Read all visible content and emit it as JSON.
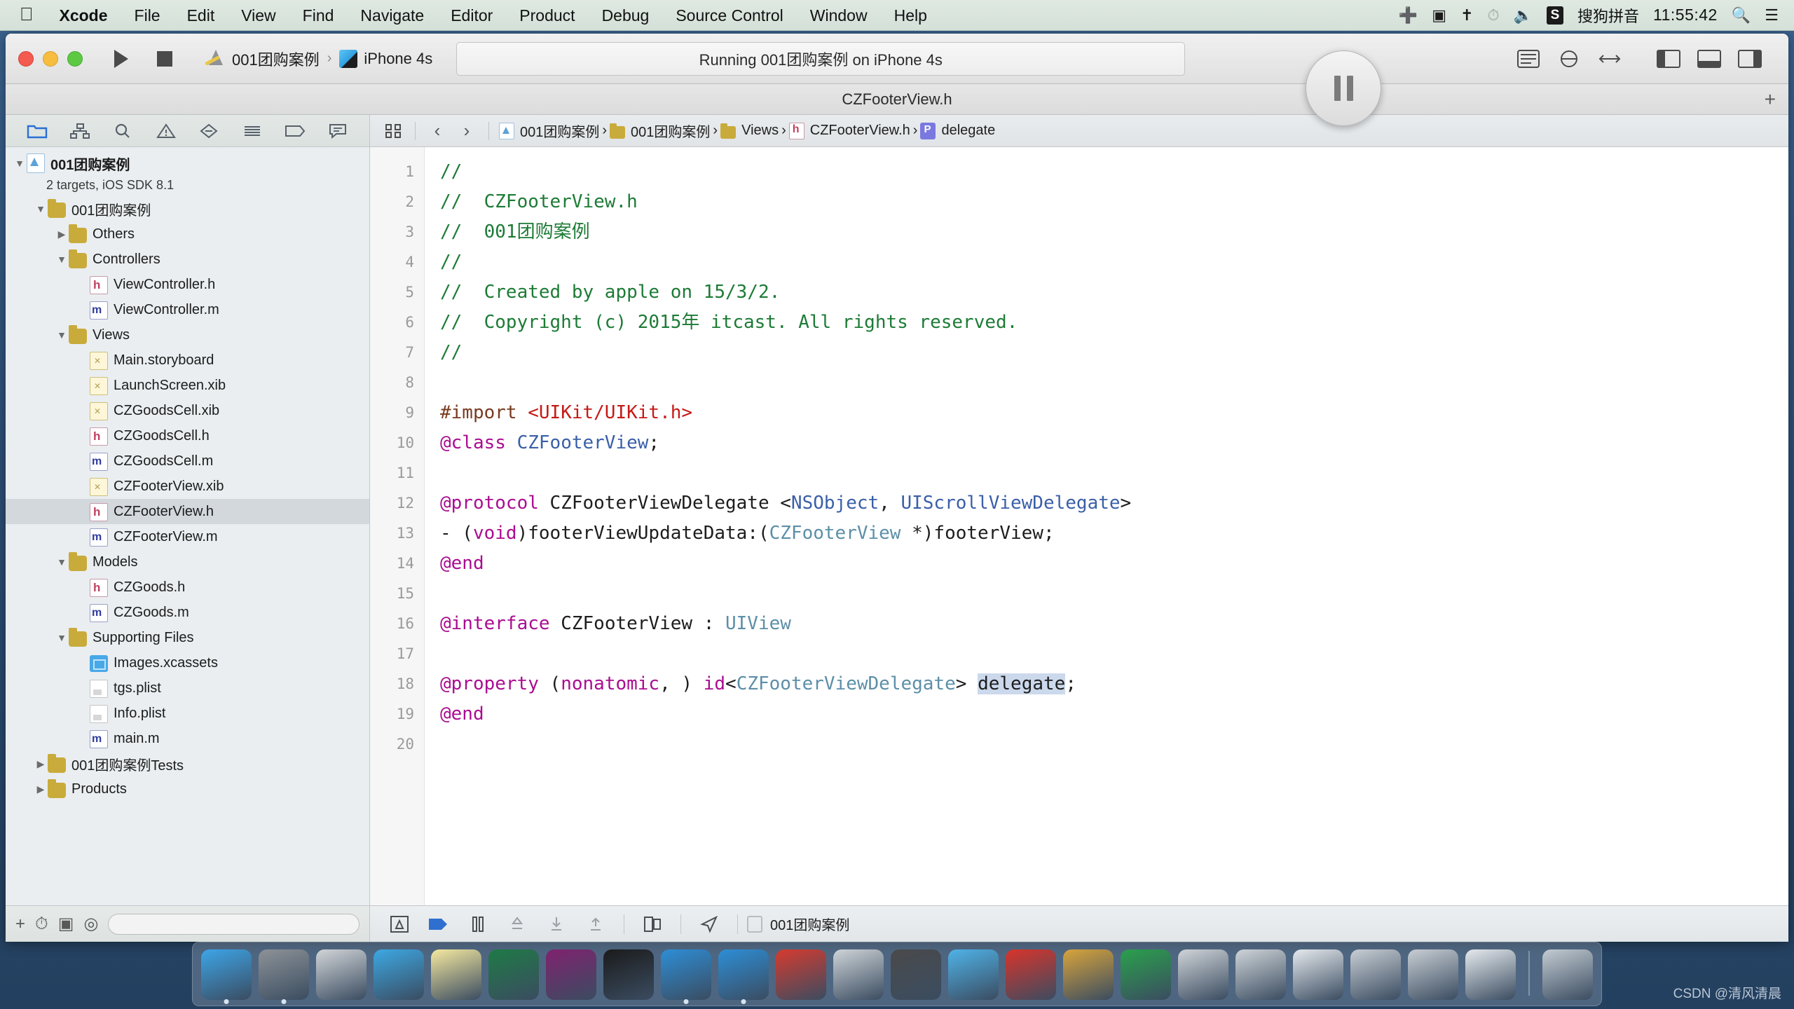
{
  "menubar": {
    "apple_icon": "apple-icon",
    "items": [
      "Xcode",
      "File",
      "Edit",
      "View",
      "Find",
      "Navigate",
      "Editor",
      "Product",
      "Debug",
      "Source Control",
      "Window",
      "Help"
    ],
    "status": {
      "airplay_icon": "airplay-icon",
      "screen_record_icon": "screen-record-icon",
      "bluetooth_icon": "bluetooth-icon",
      "timemachine_icon": "time-machine-icon",
      "volume_icon": "volume-icon",
      "input_badge": "S",
      "input_method": "搜狗拼音",
      "clock": "11:55:42",
      "search_icon": "search-icon",
      "notification_icon": "notification-center-icon"
    }
  },
  "toolbar": {
    "run_label": "Run",
    "stop_label": "Stop",
    "scheme": "001团购案例",
    "destination": "iPhone 4s",
    "activity_status": "Running 001团购案例 on iPhone 4s",
    "pause_label": "Pause",
    "editor_standard": "standard-editor",
    "editor_assistant": "assistant-editor",
    "editor_version": "version-editor",
    "view_navigator": "toggle-navigator",
    "view_debug": "toggle-debug-area",
    "view_utilities": "toggle-utilities"
  },
  "titlebar": {
    "title": "CZFooterView.h",
    "add_tab": "+"
  },
  "navigator": {
    "tabs": [
      {
        "name": "project-navigator",
        "icon": "folder-icon",
        "active": true
      },
      {
        "name": "symbol-navigator",
        "icon": "hierarchy-icon",
        "active": false
      },
      {
        "name": "find-navigator",
        "icon": "search-icon",
        "active": false
      },
      {
        "name": "issue-navigator",
        "icon": "warning-icon",
        "active": false
      },
      {
        "name": "test-navigator",
        "icon": "diamond-icon",
        "active": false
      },
      {
        "name": "debug-navigator",
        "icon": "list-icon",
        "active": false
      },
      {
        "name": "breakpoint-navigator",
        "icon": "tag-icon",
        "active": false
      },
      {
        "name": "log-navigator",
        "icon": "speech-icon",
        "active": false
      }
    ],
    "tree": [
      {
        "label": "001团购案例",
        "sub": "2 targets, iOS SDK 8.1",
        "indent": 0,
        "twisty": "down",
        "icon": "proj",
        "bold": true
      },
      {
        "label": "001团购案例",
        "indent": 1,
        "twisty": "down",
        "icon": "folder"
      },
      {
        "label": "Others",
        "indent": 2,
        "twisty": "right",
        "icon": "folder"
      },
      {
        "label": "Controllers",
        "indent": 2,
        "twisty": "down",
        "icon": "folder"
      },
      {
        "label": "ViewController.h",
        "indent": 3,
        "twisty": "",
        "icon": "h-file"
      },
      {
        "label": "ViewController.m",
        "indent": 3,
        "twisty": "",
        "icon": "m-file"
      },
      {
        "label": "Views",
        "indent": 2,
        "twisty": "down",
        "icon": "folder"
      },
      {
        "label": "Main.storyboard",
        "indent": 3,
        "twisty": "",
        "icon": "xib"
      },
      {
        "label": "LaunchScreen.xib",
        "indent": 3,
        "twisty": "",
        "icon": "xib"
      },
      {
        "label": "CZGoodsCell.xib",
        "indent": 3,
        "twisty": "",
        "icon": "xib"
      },
      {
        "label": "CZGoodsCell.h",
        "indent": 3,
        "twisty": "",
        "icon": "h-file"
      },
      {
        "label": "CZGoodsCell.m",
        "indent": 3,
        "twisty": "",
        "icon": "m-file"
      },
      {
        "label": "CZFooterView.xib",
        "indent": 3,
        "twisty": "",
        "icon": "xib"
      },
      {
        "label": "CZFooterView.h",
        "indent": 3,
        "twisty": "",
        "icon": "h-file",
        "selected": true
      },
      {
        "label": "CZFooterView.m",
        "indent": 3,
        "twisty": "",
        "icon": "m-file"
      },
      {
        "label": "Models",
        "indent": 2,
        "twisty": "down",
        "icon": "folder"
      },
      {
        "label": "CZGoods.h",
        "indent": 3,
        "twisty": "",
        "icon": "h-file"
      },
      {
        "label": "CZGoods.m",
        "indent": 3,
        "twisty": "",
        "icon": "m-file"
      },
      {
        "label": "Supporting Files",
        "indent": 2,
        "twisty": "down",
        "icon": "folder"
      },
      {
        "label": "Images.xcassets",
        "indent": 3,
        "twisty": "",
        "icon": "xcassets"
      },
      {
        "label": "tgs.plist",
        "indent": 3,
        "twisty": "",
        "icon": "plist"
      },
      {
        "label": "Info.plist",
        "indent": 3,
        "twisty": "",
        "icon": "plist"
      },
      {
        "label": "main.m",
        "indent": 3,
        "twisty": "",
        "icon": "m-file"
      },
      {
        "label": "001团购案例Tests",
        "indent": 1,
        "twisty": "right",
        "icon": "folder"
      },
      {
        "label": "Products",
        "indent": 1,
        "twisty": "right",
        "icon": "folder"
      }
    ],
    "filter_placeholder": "",
    "add_button": "+",
    "recent_button": "recent-icon",
    "sourcecontrol_button": "source-control-icon",
    "filter_button": "filter-icon"
  },
  "jumpbar": {
    "related_icon": "related-items-icon",
    "back": "‹",
    "forward": "›",
    "crumbs": [
      {
        "label": "001团购案例",
        "icon": "proj"
      },
      {
        "label": "001团购案例",
        "icon": "folder"
      },
      {
        "label": "Views",
        "icon": "folder"
      },
      {
        "label": "CZFooterView.h",
        "icon": "h"
      },
      {
        "label": "delegate",
        "icon": "p"
      }
    ]
  },
  "code": {
    "line_numbers": [
      "1",
      "2",
      "3",
      "4",
      "5",
      "6",
      "7",
      "8",
      "9",
      "10",
      "11",
      "12",
      "13",
      "14",
      "15",
      "16",
      "17",
      "18",
      "19",
      "20"
    ],
    "lines": [
      {
        "n": 1,
        "tokens": [
          {
            "t": "//",
            "c": "cm"
          }
        ]
      },
      {
        "n": 2,
        "tokens": [
          {
            "t": "//  CZFooterView.h",
            "c": "cm"
          }
        ]
      },
      {
        "n": 3,
        "tokens": [
          {
            "t": "//  001团购案例",
            "c": "cm"
          }
        ]
      },
      {
        "n": 4,
        "tokens": [
          {
            "t": "//",
            "c": "cm"
          }
        ]
      },
      {
        "n": 5,
        "tokens": [
          {
            "t": "//  Created by apple on 15/3/2.",
            "c": "cm"
          }
        ]
      },
      {
        "n": 6,
        "tokens": [
          {
            "t": "//  Copyright (c) 2015年 itcast. All rights reserved.",
            "c": "cm"
          }
        ]
      },
      {
        "n": 7,
        "tokens": [
          {
            "t": "//",
            "c": "cm"
          }
        ]
      },
      {
        "n": 8,
        "tokens": []
      },
      {
        "n": 9,
        "tokens": [
          {
            "t": "#import ",
            "c": "pre"
          },
          {
            "t": "<UIKit/UIKit.h>",
            "c": "str"
          }
        ]
      },
      {
        "n": 10,
        "tokens": [
          {
            "t": "@class",
            "c": "kw"
          },
          {
            "t": " ",
            "c": ""
          },
          {
            "t": "CZFooterView",
            "c": "cls"
          },
          {
            "t": ";",
            "c": ""
          }
        ]
      },
      {
        "n": 11,
        "tokens": []
      },
      {
        "n": 12,
        "tokens": [
          {
            "t": "@protocol",
            "c": "kw"
          },
          {
            "t": " CZFooterViewDelegate <",
            "c": ""
          },
          {
            "t": "NSObject",
            "c": "cls"
          },
          {
            "t": ", ",
            "c": ""
          },
          {
            "t": "UIScrollViewDelegate",
            "c": "cls"
          },
          {
            "t": ">",
            "c": ""
          }
        ]
      },
      {
        "n": 13,
        "tokens": [
          {
            "t": "- (",
            "c": ""
          },
          {
            "t": "void",
            "c": "kw"
          },
          {
            "t": ")footerViewUpdateData:(",
            "c": ""
          },
          {
            "t": "CZFooterView",
            "c": "typ"
          },
          {
            "t": " *)footerView;",
            "c": ""
          }
        ]
      },
      {
        "n": 14,
        "tokens": [
          {
            "t": "@end",
            "c": "kw"
          }
        ]
      },
      {
        "n": 15,
        "tokens": []
      },
      {
        "n": 16,
        "tokens": [
          {
            "t": "@interface",
            "c": "kw"
          },
          {
            "t": " CZFooterView : ",
            "c": ""
          },
          {
            "t": "UIView",
            "c": "typ"
          }
        ]
      },
      {
        "n": 17,
        "tokens": []
      },
      {
        "n": 18,
        "tokens": [
          {
            "t": "@property",
            "c": "kw"
          },
          {
            "t": " (",
            "c": ""
          },
          {
            "t": "nonatomic",
            "c": "kw"
          },
          {
            "t": ", ) ",
            "c": ""
          },
          {
            "t": "id",
            "c": "kw"
          },
          {
            "t": "<",
            "c": ""
          },
          {
            "t": "CZFooterViewDelegate",
            "c": "typ"
          },
          {
            "t": "> ",
            "c": ""
          },
          {
            "t": "delegate",
            "c": "sel"
          },
          {
            "t": ";",
            "c": ""
          }
        ]
      },
      {
        "n": 19,
        "tokens": [
          {
            "t": "@end",
            "c": "kw"
          }
        ]
      },
      {
        "n": 20,
        "tokens": []
      }
    ]
  },
  "editor_bottom": {
    "icons": [
      "debug-view-hierarchy-icon",
      "continue-icon",
      "pause-icon",
      "step-over-icon",
      "step-into-icon",
      "step-out-icon",
      "simulate-location-icon",
      "location-icon"
    ],
    "process_label": "001团购案例",
    "process_icon": "app-icon"
  },
  "dock": {
    "items": [
      {
        "name": "finder",
        "color": "#3da5e8"
      },
      {
        "name": "system-preferences",
        "color": "#8d9297"
      },
      {
        "name": "launchpad",
        "color": "#d2d5d8"
      },
      {
        "name": "safari",
        "color": "#3ca8e3"
      },
      {
        "name": "notes",
        "color": "#f6e9a0"
      },
      {
        "name": "excel",
        "color": "#1f7a46"
      },
      {
        "name": "onenote",
        "color": "#80226f"
      },
      {
        "name": "terminal",
        "color": "#1b1b1b"
      },
      {
        "name": "xcode",
        "color": "#2d8ed6"
      },
      {
        "name": "simulator",
        "color": "#2d8ed6"
      },
      {
        "name": "prototype",
        "color": "#d63b2f"
      },
      {
        "name": "snipaste",
        "color": "#cfd4d8"
      },
      {
        "name": "quicktime",
        "color": "#4a4a4a"
      },
      {
        "name": "qq",
        "color": "#4fb3e8"
      },
      {
        "name": "filezilla",
        "color": "#d9342b"
      },
      {
        "name": "charles",
        "color": "#d8a43c"
      },
      {
        "name": "wechat",
        "color": "#2aa04c"
      },
      {
        "name": "appstore",
        "color": "#d0d4d8"
      },
      {
        "name": "xcode-beta",
        "color": "#cfd4d8"
      },
      {
        "name": "window-1",
        "color": "#e6eaee"
      },
      {
        "name": "window-2",
        "color": "#c8ced4"
      },
      {
        "name": "window-3",
        "color": "#c8ced4"
      },
      {
        "name": "window-4",
        "color": "#e6eaee"
      },
      {
        "name": "trash",
        "color": "#c4ccd3"
      }
    ]
  },
  "watermark": "CSDN @清风清晨"
}
